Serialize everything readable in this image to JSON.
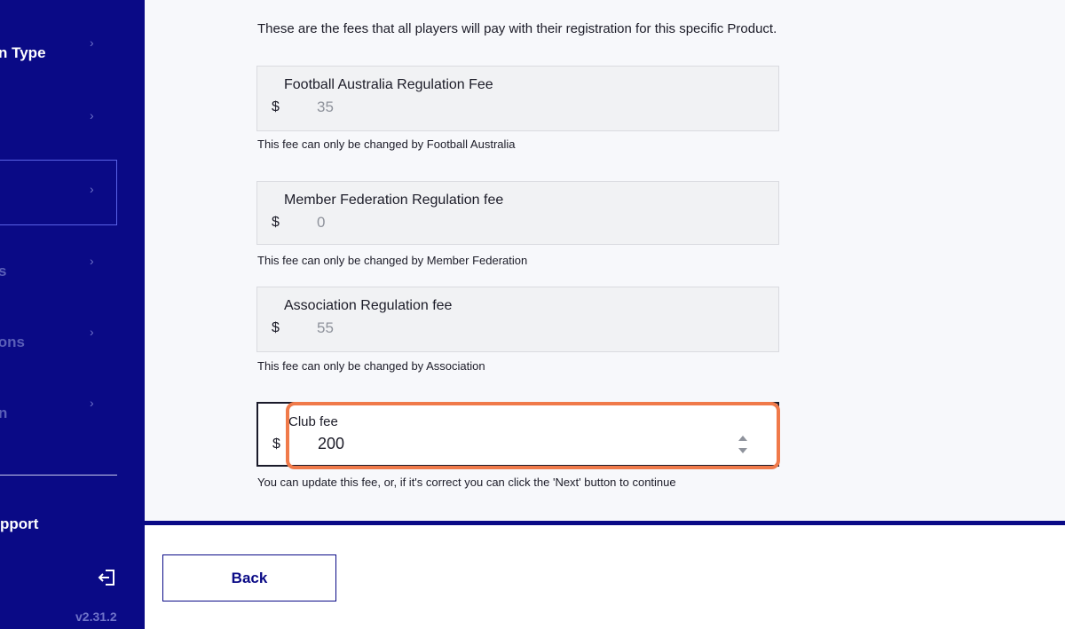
{
  "sidebar": {
    "items": [
      {
        "label": "n Type"
      },
      {
        "label": ""
      },
      {
        "label": ""
      },
      {
        "label": "s"
      },
      {
        "label": "ons"
      },
      {
        "label": "n"
      }
    ],
    "support_label": "pport",
    "version": "v2.31.2"
  },
  "main": {
    "intro": "These are the fees that all players will pay with their registration for this specific Product.",
    "fees": [
      {
        "label": "Football Australia Regulation Fee",
        "currency": "$",
        "value": "35",
        "note": "This fee can only be changed by Football Australia"
      },
      {
        "label": "Member Federation Regulation fee",
        "currency": "$",
        "value": "0",
        "note": "This fee can only be changed by Member Federation"
      },
      {
        "label": "Association Regulation fee",
        "currency": "$",
        "value": "55",
        "note": "This fee can only be changed by Association"
      }
    ],
    "club_fee": {
      "label": "Club fee",
      "currency": "$",
      "value": "200",
      "note": "You can update this fee, or, if it's correct you can click the 'Next' button to continue"
    }
  },
  "footer": {
    "back_label": "Back"
  },
  "colors": {
    "sidebar_bg": "#0a0a86",
    "highlight": "#f07a4a"
  }
}
